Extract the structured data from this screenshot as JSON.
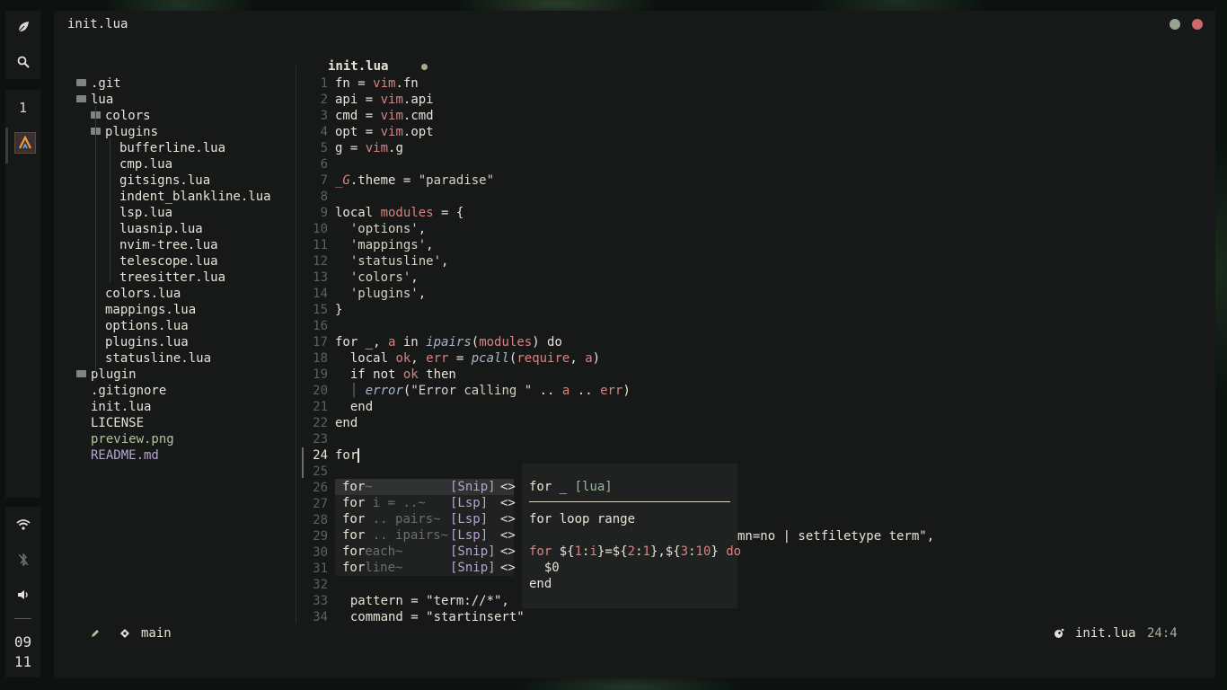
{
  "sidebar": {
    "workspace": "1",
    "clock": {
      "hour": "09",
      "minute": "11"
    }
  },
  "window": {
    "title": "init.lua",
    "dot_green": "#96a38f",
    "dot_red": "#cf6a6a"
  },
  "tree": {
    "items": [
      {
        "label": ".git",
        "type": "folder",
        "depth": 1
      },
      {
        "label": "lua",
        "type": "folder-open",
        "depth": 1
      },
      {
        "label": "colors",
        "type": "folder",
        "depth": 2
      },
      {
        "label": "plugins",
        "type": "folder-open",
        "depth": 2
      },
      {
        "label": "bufferline.lua",
        "type": "file",
        "depth": 3
      },
      {
        "label": "cmp.lua",
        "type": "file",
        "depth": 3
      },
      {
        "label": "gitsigns.lua",
        "type": "file",
        "depth": 3
      },
      {
        "label": "indent_blankline.lua",
        "type": "file",
        "depth": 3
      },
      {
        "label": "lsp.lua",
        "type": "file",
        "depth": 3
      },
      {
        "label": "luasnip.lua",
        "type": "file",
        "depth": 3
      },
      {
        "label": "nvim-tree.lua",
        "type": "file",
        "depth": 3
      },
      {
        "label": "telescope.lua",
        "type": "file",
        "depth": 3
      },
      {
        "label": "treesitter.lua",
        "type": "file",
        "depth": 3
      },
      {
        "label": "colors.lua",
        "type": "file",
        "depth": 2
      },
      {
        "label": "mappings.lua",
        "type": "file",
        "depth": 2
      },
      {
        "label": "options.lua",
        "type": "file",
        "depth": 2
      },
      {
        "label": "plugins.lua",
        "type": "file",
        "depth": 2
      },
      {
        "label": "statusline.lua",
        "type": "file",
        "depth": 2
      },
      {
        "label": "plugin",
        "type": "folder",
        "depth": 1
      },
      {
        "label": ".gitignore",
        "type": "file",
        "depth": 0
      },
      {
        "label": "init.lua",
        "type": "file",
        "depth": 0
      },
      {
        "label": "LICENSE",
        "type": "file",
        "depth": 0
      },
      {
        "label": "preview.png",
        "type": "image",
        "depth": 0
      },
      {
        "label": "README.md",
        "type": "markdown",
        "depth": 0
      }
    ]
  },
  "editor": {
    "tab_label": "init.lua",
    "lines": [
      "1",
      "2",
      "3",
      "4",
      "5",
      "6",
      "7",
      "8",
      "9",
      "10",
      "11",
      "12",
      "13",
      "14",
      "15",
      "16",
      "17",
      "18",
      "19",
      "20",
      "21",
      "22",
      "23",
      "24",
      "25",
      "26",
      "27",
      "28",
      "29",
      "30",
      "31",
      "32",
      "33",
      "34"
    ],
    "current_line": "24",
    "typed": "for",
    "line30_tail": "mn=no | setfiletype term\",",
    "line33": "  pattern = \"term://*\",",
    "line34": "  command = \"startinsert\""
  },
  "completion": {
    "items": [
      {
        "match": "for",
        "rest": "~",
        "kind": "[Snip]",
        "arrows": "<>"
      },
      {
        "match": "for",
        "rest": " i = ..~",
        "kind": "[Lsp]",
        "arrows": "<>"
      },
      {
        "match": "for",
        "rest": " .. pairs~",
        "kind": "[Lsp]",
        "arrows": "<>"
      },
      {
        "match": "for",
        "rest": " .. ipairs~",
        "kind": "[Lsp]",
        "arrows": "<>"
      },
      {
        "match": "for",
        "rest": "each~",
        "kind": "[Snip]",
        "arrows": "<>"
      },
      {
        "match": "for",
        "rest": "line~",
        "kind": "[Snip]",
        "arrows": "<>"
      }
    ],
    "doc": {
      "header": "for _",
      "lang": "[lua]",
      "desc": "for loop range",
      "body_1": "$0",
      "body_2": "end"
    }
  },
  "statusline": {
    "branch": "main",
    "file": "init.lua",
    "position": "24:4"
  }
}
